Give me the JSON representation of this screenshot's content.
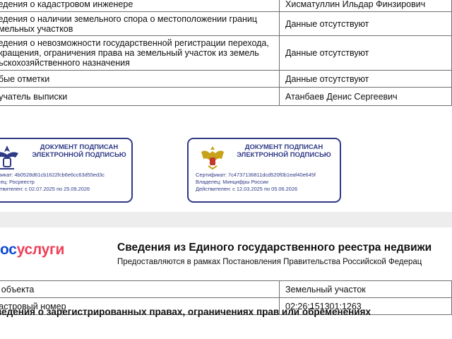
{
  "top_table": {
    "rows": [
      {
        "key": "ведения о кадастровом инженере",
        "value": "Хисматуллин Ильдар Финзирович"
      },
      {
        "key": "ведения о наличии земельного спора о местоположении границ\nемельных участков",
        "value": "Данные отсутствуют"
      },
      {
        "key": "ведения о невозможности государственной регистрации перехода,\nекращения, ограничения права на земельный участок из земель\nльскохозяйственного назначения",
        "value": "Данные отсутствуют"
      },
      {
        "key": "обые отметки",
        "value": "Данные отсутствуют"
      },
      {
        "key": "лучатель выписки",
        "value": "Атанбаев Денис Сергеевич"
      }
    ]
  },
  "stamps": [
    {
      "title": "ДОКУМЕНТ ПОДПИСАН ЭЛЕКТРОННОЙ ПОДПИСЬЮ",
      "emblem": "rosreestr-emblem",
      "cert": "тификат: 4b0528d61cb1622fcb6e6cc63d55ed3c",
      "owner": "делец: Росреестр",
      "valid": "ействителен: с 02.07.2025 по 25.09.2026"
    },
    {
      "title": "ДОКУМЕНТ ПОДПИСАН ЭЛЕКТРОННОЙ ПОДПИСЬЮ",
      "emblem": "russia-coat-of-arms",
      "cert": "Сертификат: 7c4737136811dcd520f0b1eaf40e645f",
      "owner": "Владелец: Минцифры России",
      "valid": "Действителен: с 12.03.2025 по 05.06.2026"
    }
  ],
  "header": {
    "logo_part1": "ос",
    "logo_part2": "услуги",
    "title": "Сведения из Единого государственного реестра недвижи",
    "subtitle": "Предоставляются в рамках Постановления Правительства Российской Федерац"
  },
  "bottom_table": {
    "rows": [
      {
        "key": "д объекта",
        "value": "Земельный участок"
      },
      {
        "key": "дастровый номер",
        "value": "02:26:151301:1263"
      }
    ]
  },
  "section_title": "ведения о зарегистрированных правах, ограничениях прав или обременениях",
  "colors": {
    "stamp": "#2f3a86",
    "gos_blue": "#0d4cd3",
    "gos_red": "#ee3f58"
  }
}
